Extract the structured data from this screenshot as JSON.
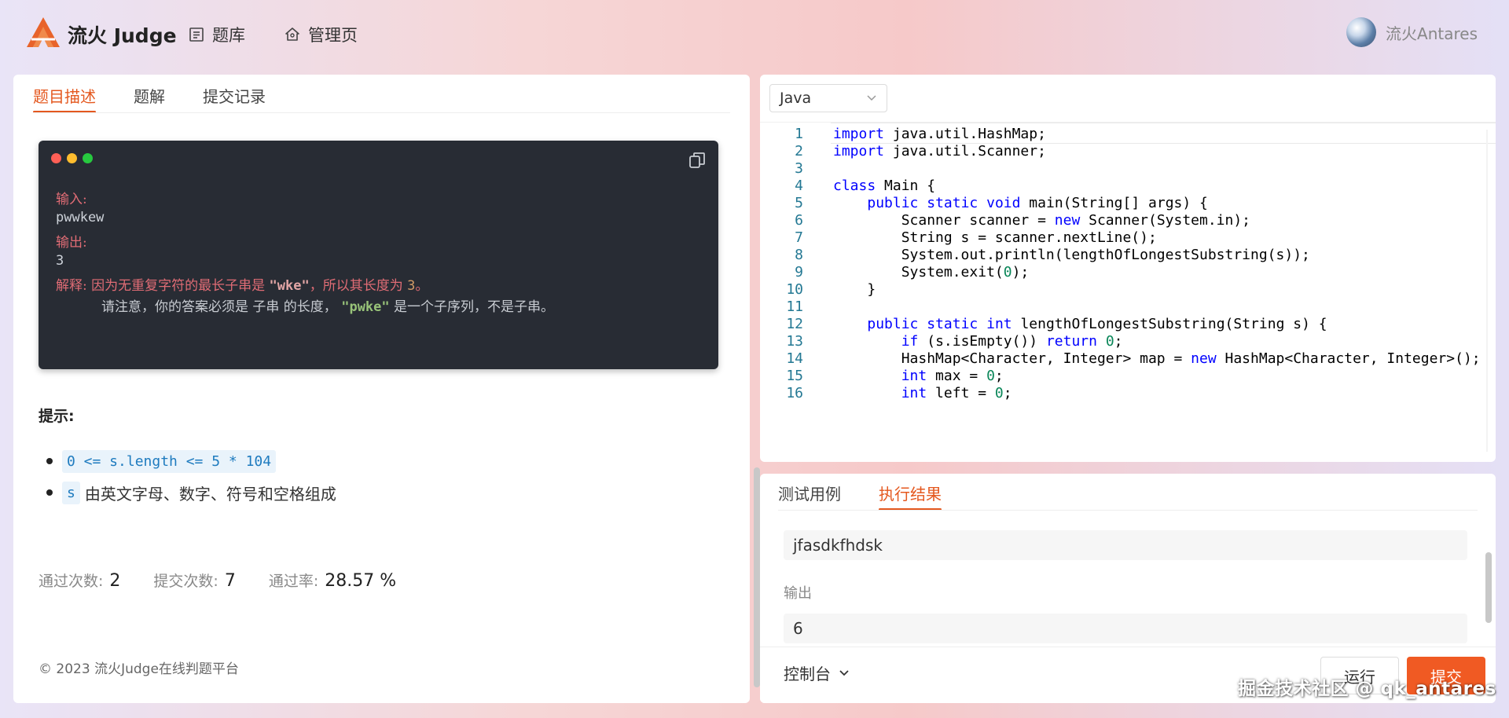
{
  "header": {
    "brand": "流火 Judge",
    "nav": [
      {
        "label": "题库",
        "icon": "list-icon"
      },
      {
        "label": "管理页",
        "icon": "house-icon"
      }
    ],
    "username": "流火Antares"
  },
  "problem": {
    "tabs": [
      "题目描述",
      "题解",
      "提交记录"
    ],
    "active_tab": "题目描述",
    "example": {
      "input_label": "输入:",
      "input_value": "pwwkew",
      "output_label": "输出:",
      "output_value": "3",
      "explain_label": "解释:",
      "explain_text_1": "因为无重复字符的最长子串是",
      "explain_str_1": "\"wke\"",
      "explain_text_2": "，所以其长度为",
      "explain_num": "3",
      "explain_text_3": "。",
      "note_text_1": "请注意，你的答案必须是 子串 的长度，",
      "note_str": "\"pwke\"",
      "note_text_2": "是一个子序列，不是子串。"
    },
    "hint_title": "提示:",
    "hints": [
      {
        "code": "0 <= s.length <= 5 * 104",
        "text": ""
      },
      {
        "code": "s",
        "text": "由英文字母、数字、符号和空格组成"
      }
    ],
    "stats": {
      "accepted_label": "通过次数:",
      "accepted_value": "2",
      "submitted_label": "提交次数:",
      "submitted_value": "7",
      "rate_label": "通过率:",
      "rate_value": "28.57 %"
    },
    "footer": "© 2023 流火Judge在线判题平台"
  },
  "editor": {
    "language": "Java",
    "lines": [
      {
        "n": "1",
        "code": "import java.util.HashMap;"
      },
      {
        "n": "2",
        "code": "import java.util.Scanner;"
      },
      {
        "n": "3",
        "code": ""
      },
      {
        "n": "4",
        "code": "class Main {"
      },
      {
        "n": "5",
        "code": "    public static void main(String[] args) {"
      },
      {
        "n": "6",
        "code": "        Scanner scanner = new Scanner(System.in);"
      },
      {
        "n": "7",
        "code": "        String s = scanner.nextLine();"
      },
      {
        "n": "8",
        "code": "        System.out.println(lengthOfLongestSubstring(s));"
      },
      {
        "n": "9",
        "code": "        System.exit(0);"
      },
      {
        "n": "10",
        "code": "    }"
      },
      {
        "n": "11",
        "code": ""
      },
      {
        "n": "12",
        "code": "    public static int lengthOfLongestSubstring(String s) {"
      },
      {
        "n": "13",
        "code": "        if (s.isEmpty()) return 0;"
      },
      {
        "n": "14",
        "code": "        HashMap<Character, Integer> map = new HashMap<Character, Integer>();"
      },
      {
        "n": "15",
        "code": "        int max = 0;"
      },
      {
        "n": "16",
        "code": "        int left = 0;"
      }
    ]
  },
  "result": {
    "tabs": [
      "测试用例",
      "执行结果"
    ],
    "active_tab": "执行结果",
    "input_value": "jfasdkfhdsk",
    "output_label": "输出",
    "output_value": "6",
    "console_label": "控制台",
    "run_label": "运行",
    "submit_label": "提交"
  },
  "watermark": "掘金技术社区 @ qk_antares",
  "colors": {
    "accent": "#e4581f",
    "submit": "#f05a23",
    "code_bg": "#282c34"
  }
}
